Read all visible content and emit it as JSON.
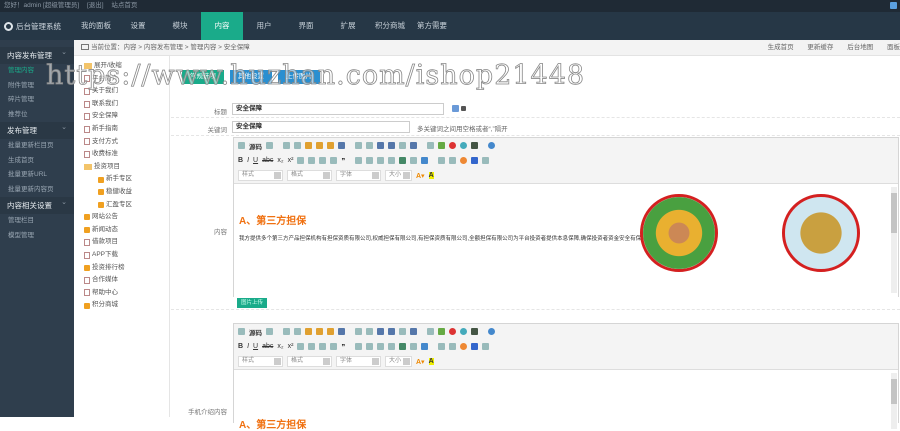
{
  "topbar": {
    "greeting": "您好！admin [超级管理员]",
    "logout": "[退出]",
    "site_home": "站点首页"
  },
  "nav": {
    "logo": "后台管理系统",
    "items": [
      "我的面板",
      "设置",
      "模块",
      "内容",
      "用户",
      "界面",
      "扩展",
      "积分商城",
      "第方需要"
    ],
    "active": "内容"
  },
  "sidebar": {
    "groups": [
      {
        "title": "内容发布管理",
        "items": [
          "管理内容",
          "附件管理",
          "碎片管理",
          "推荐位"
        ]
      },
      {
        "title": "发布管理",
        "items": [
          "批量更新栏目页",
          "生成首页",
          "批量更新URL",
          "批量更新内容页"
        ]
      },
      {
        "title": "内容相关设置",
        "items": [
          "管理栏目",
          "模型管理"
        ]
      }
    ]
  },
  "breadcrumb": {
    "text": "当前位置：内容 > 内容发布管理 > 管理内容 > 安全保障",
    "links": [
      "生成首页",
      "更新缓存",
      "后台地图",
      "面板"
    ]
  },
  "tree": [
    {
      "label": "展开/收缩",
      "type": "root"
    },
    {
      "label": "平台简介",
      "type": "doc"
    },
    {
      "label": "关于我们",
      "type": "doc"
    },
    {
      "label": "联系我们",
      "type": "doc"
    },
    {
      "label": "安全保障",
      "type": "doc"
    },
    {
      "label": "新手指南",
      "type": "doc"
    },
    {
      "label": "支付方式",
      "type": "doc"
    },
    {
      "label": "收费标准",
      "type": "doc"
    },
    {
      "label": "投资项目",
      "type": "folder"
    },
    {
      "label": "新手专区",
      "type": "plus",
      "child": true
    },
    {
      "label": "稳健收益",
      "type": "plus",
      "child": true
    },
    {
      "label": "汇盈专区",
      "type": "plus",
      "child": true
    },
    {
      "label": "网站公告",
      "type": "plus"
    },
    {
      "label": "新闻动态",
      "type": "plus"
    },
    {
      "label": "借款项目",
      "type": "doc"
    },
    {
      "label": "APP下载",
      "type": "doc"
    },
    {
      "label": "投资排行榜",
      "type": "plus"
    },
    {
      "label": "合作媒体",
      "type": "doc"
    },
    {
      "label": "帮助中心",
      "type": "doc"
    },
    {
      "label": "积分商城",
      "type": "plus"
    }
  ],
  "form": {
    "tabs": [
      "常规选项",
      "其他设置",
      "上传图片"
    ],
    "title_label": "标题",
    "title_value": "安全保障",
    "keyword_label": "关键词",
    "keyword_value": "安全保障",
    "keyword_hint": "多关键词之间用空格或者“,”隔开",
    "content_label": "内容",
    "mobile_label": "手机介绍内容",
    "source_btn": "源码",
    "style_sel": "样式",
    "format_sel": "格式",
    "font_sel": "字体",
    "size_sel": "大小",
    "content_heading": "A、第三方担保",
    "content_para": "我方提供多个第三方产品担保机构有担保资质有限公司,权威担保有限公司,有担保资质有限公司,全额担保有限公司为平台投资者提供本息保障,确保投资者资金安全有保障.",
    "upload_btn": "图片上传",
    "mobile_heading": "A、第三方担保"
  },
  "watermark": "https://www.huzhan.com/ishop21448"
}
